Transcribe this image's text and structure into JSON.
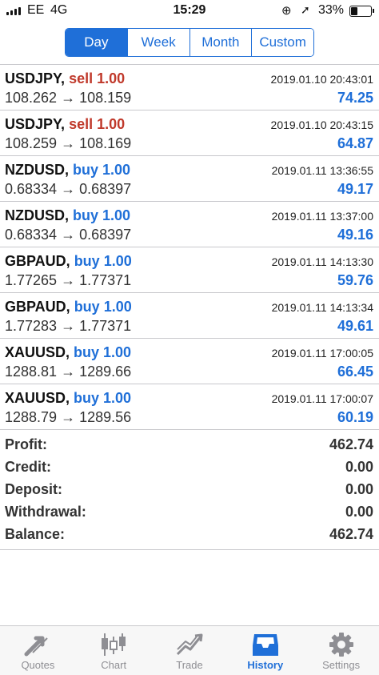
{
  "status_bar": {
    "carrier": "EE",
    "network": "4G",
    "time": "15:29",
    "battery": "33%"
  },
  "periods": [
    "Day",
    "Week",
    "Month",
    "Custom"
  ],
  "selected_period": "Day",
  "trades": [
    {
      "symbol": "USDJPY,",
      "side": "sell 1.00",
      "type": "sell",
      "datetime": "2019.01.10 20:43:01",
      "prices": "108.262 → 108.159",
      "profit": "74.25"
    },
    {
      "symbol": "USDJPY,",
      "side": "sell 1.00",
      "type": "sell",
      "datetime": "2019.01.10 20:43:15",
      "prices": "108.259 → 108.169",
      "profit": "64.87"
    },
    {
      "symbol": "NZDUSD,",
      "side": "buy 1.00",
      "type": "buy",
      "datetime": "2019.01.11 13:36:55",
      "prices": "0.68334 → 0.68397",
      "profit": "49.17"
    },
    {
      "symbol": "NZDUSD,",
      "side": "buy 1.00",
      "type": "buy",
      "datetime": "2019.01.11 13:37:00",
      "prices": "0.68334 → 0.68397",
      "profit": "49.16"
    },
    {
      "symbol": "GBPAUD,",
      "side": "buy 1.00",
      "type": "buy",
      "datetime": "2019.01.11 14:13:30",
      "prices": "1.77265 → 1.77371",
      "profit": "59.76"
    },
    {
      "symbol": "GBPAUD,",
      "side": "buy 1.00",
      "type": "buy",
      "datetime": "2019.01.11 14:13:34",
      "prices": "1.77283 → 1.77371",
      "profit": "49.61"
    },
    {
      "symbol": "XAUUSD,",
      "side": "buy 1.00",
      "type": "buy",
      "datetime": "2019.01.11 17:00:05",
      "prices": "1288.81 → 1289.66",
      "profit": "66.45"
    },
    {
      "symbol": "XAUUSD,",
      "side": "buy 1.00",
      "type": "buy",
      "datetime": "2019.01.11 17:00:07",
      "prices": "1288.79 → 1289.56",
      "profit": "60.19"
    }
  ],
  "summary": [
    {
      "label": "Profit:",
      "value": "462.74"
    },
    {
      "label": "Credit:",
      "value": "0.00"
    },
    {
      "label": "Deposit:",
      "value": "0.00"
    },
    {
      "label": "Withdrawal:",
      "value": "0.00"
    },
    {
      "label": "Balance:",
      "value": "462.74"
    }
  ],
  "tabs": [
    {
      "label": "Quotes",
      "icon": "quotes-icon"
    },
    {
      "label": "Chart",
      "icon": "chart-icon"
    },
    {
      "label": "Trade",
      "icon": "trade-icon"
    },
    {
      "label": "History",
      "icon": "history-icon"
    },
    {
      "label": "Settings",
      "icon": "settings-icon"
    }
  ],
  "active_tab": "History",
  "colors": {
    "accent": "#1f6fd8",
    "sell": "#c0392b",
    "buy": "#1f6fd8",
    "inactive_tab": "#8e8e93"
  }
}
